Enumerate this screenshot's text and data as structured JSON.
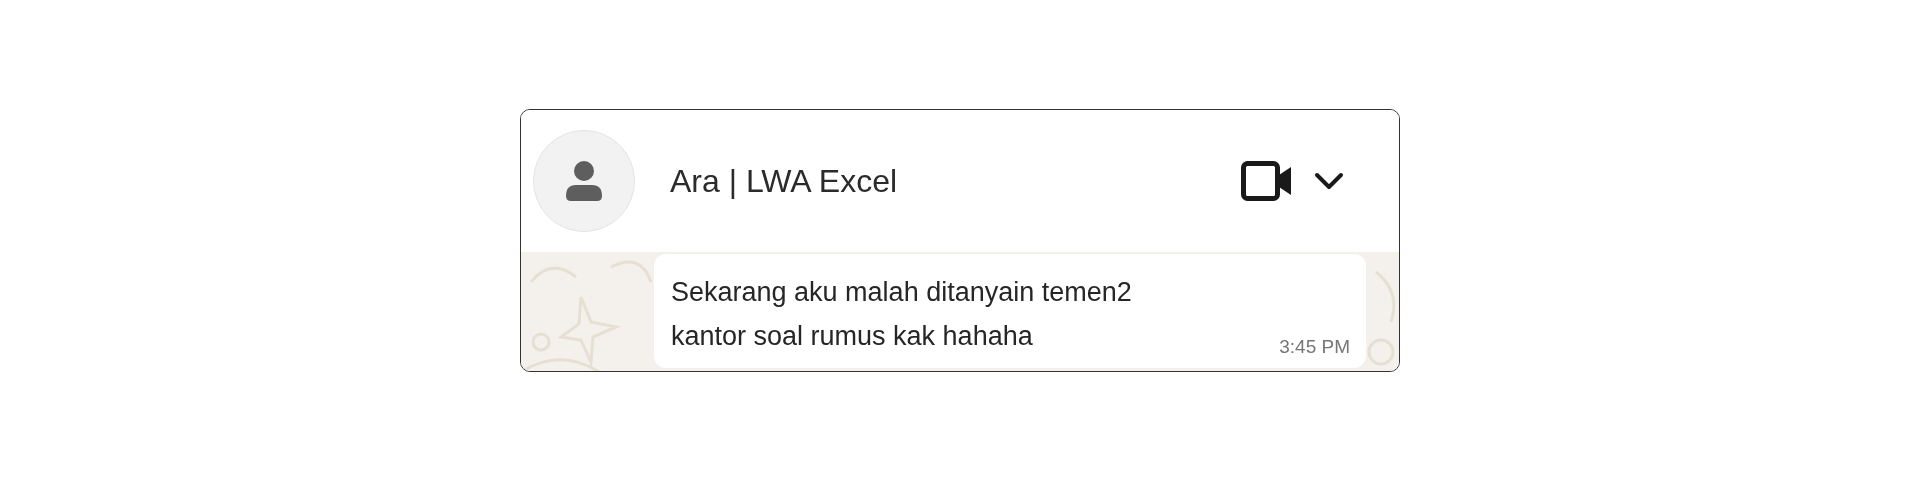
{
  "header": {
    "contact_name": "Ara | LWA Excel"
  },
  "messages": [
    {
      "text": "Sekarang aku malah ditanyain temen2 kantor soal rumus kak hahaha",
      "time": "3:45 PM"
    }
  ]
}
